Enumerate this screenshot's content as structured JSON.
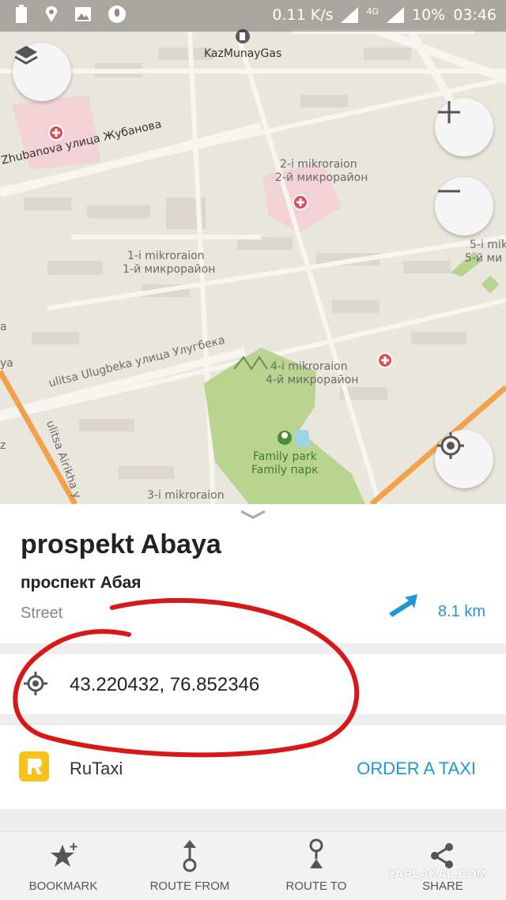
{
  "status_bar": {
    "speed": "0.11 K/s",
    "network": "4G",
    "battery": "10%",
    "time": "03:46"
  },
  "map": {
    "labels": {
      "gas_station": "KazMunayGas",
      "street_zhubanova": "Zhubanova  улица Жубанова",
      "mkr2_latin": "2-i mikroraion",
      "mkr2_cyr": "2-й микрорайон",
      "mkr1_latin": "1-i mikroraion",
      "mkr1_cyr": "1-й микрорайон",
      "mkr5_latin": "5-i mikr",
      "mkr5_cyr": "5-й ми",
      "mkr4_latin": "4-i mikroraion",
      "mkr4_cyr": "4-й микрорайон",
      "street_ulugbeka": "ulitsa Ulugbeka  улица Улугбека",
      "park_latin": "Family park",
      "park_cyr": "Family парк",
      "street_airikha": "ulitsa Airikha  у",
      "mkr3_latin": "3-i mikroraion",
      "edge_a": "a",
      "edge_ya": "ya",
      "edge_z": "z"
    }
  },
  "place": {
    "title": "prospekt Abaya",
    "subtitle": "проспект Абая",
    "type": "Street",
    "distance": "8.1 km"
  },
  "coordinates": "43.220432, 76.852346",
  "taxi": {
    "name": "RuTaxi",
    "action": "ORDER A TAXI"
  },
  "bottom_bar": {
    "bookmark": "BOOKMARK",
    "route_from": "ROUTE FROM",
    "route_to": "ROUTE TO",
    "share": "SHARE"
  },
  "watermark": "YAPLAKAL.COM",
  "colors": {
    "accent": "#2196d6",
    "annotation": "#d81818",
    "park": "#b9d48f",
    "hospital_area": "#f2d2d6",
    "road_orange": "#f2a24a",
    "taxi_icon": "#f6c21b"
  }
}
